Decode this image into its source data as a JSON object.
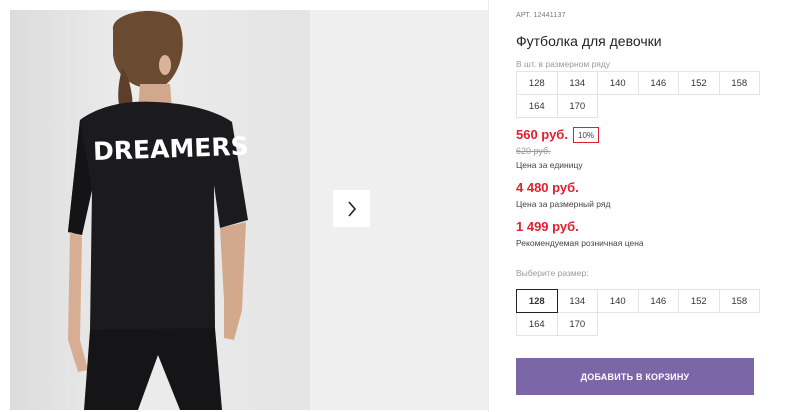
{
  "gallery": {
    "print_text": "DREAMERS",
    "next_icon": "chevron-right-icon"
  },
  "product": {
    "article_label": "АРТ.",
    "article_value": "12441137",
    "title": "Футболка для девочки",
    "row_sizes_label": "В шт. в размерном ряду",
    "row_sizes": [
      "128",
      "134",
      "140",
      "146",
      "152",
      "158",
      "164",
      "170"
    ],
    "price": "560 руб.",
    "discount": "10%",
    "old_price": "620 руб.",
    "price_unit_note": "Цена за единицу",
    "row_price": "4 480 руб.",
    "row_price_note": "Цена за размерный ряд",
    "rrp": "1 499 руб.",
    "rrp_note": "Рекомендуемая розничная цена",
    "choose_size_label": "Выберите размер:",
    "choose_sizes": [
      "128",
      "134",
      "140",
      "146",
      "152",
      "158",
      "164",
      "170"
    ],
    "selected_size": "128",
    "cart_button": "ДОБАВИТЬ В КОРЗИНУ"
  },
  "colors": {
    "accent_red": "#e0202e",
    "button_purple": "#7b66a8"
  }
}
